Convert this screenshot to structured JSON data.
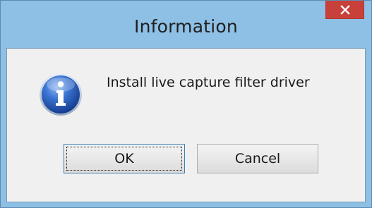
{
  "window": {
    "title": "Information",
    "close_icon": "close-icon"
  },
  "dialog": {
    "icon": "info-icon",
    "message": "Install live capture filter driver",
    "ok_label": "OK",
    "cancel_label": "Cancel"
  },
  "colors": {
    "frame": "#8ec0e6",
    "close_button": "#c7403a",
    "client_background": "#f0f0f0",
    "icon_blue": "#2a62c4"
  }
}
